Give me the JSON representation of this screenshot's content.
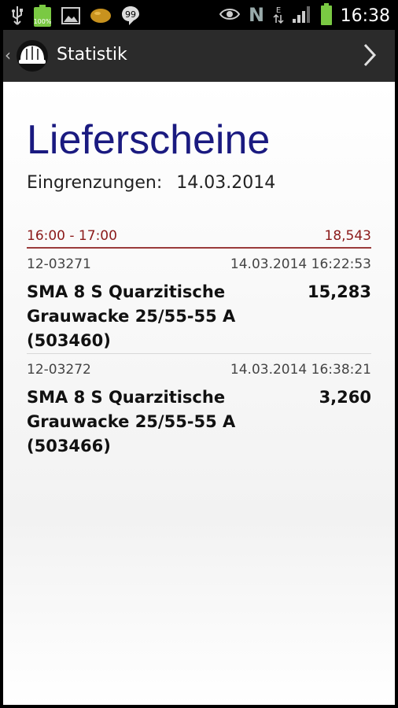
{
  "status_bar": {
    "time": "16:38",
    "left_icons": [
      "usb-icon",
      "battery-app-icon",
      "image-icon",
      "potato-icon",
      "chat-icon"
    ],
    "right_icons": [
      "eye-icon",
      "nfc-icon",
      "data-icon",
      "signal-icon",
      "battery-icon"
    ]
  },
  "action_bar": {
    "title": "Statistik"
  },
  "page": {
    "title": "Lieferscheine",
    "filter_label": "Eingrenzungen:",
    "filter_value": "14.03.2014"
  },
  "group": {
    "time_range": "16:00 - 17:00",
    "total": "18,543"
  },
  "items": [
    {
      "id": "12-03271",
      "timestamp": "14.03.2014 16:22:53",
      "description": "SMA 8 S Quarzitische Grauwacke 25/55-55 A (503460)",
      "quantity": "15,283"
    },
    {
      "id": "12-03272",
      "timestamp": "14.03.2014 16:38:21",
      "description": "SMA 8 S Quarzitische Grauwacke 25/55-55 A (503466)",
      "quantity": "3,260"
    }
  ]
}
